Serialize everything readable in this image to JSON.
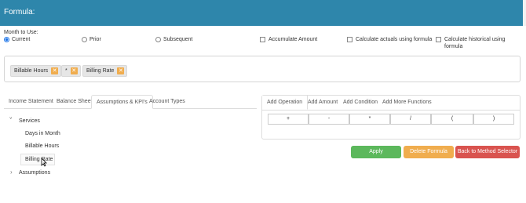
{
  "header": {
    "title": "Formula:"
  },
  "month": {
    "label": "Month to Use:",
    "options": [
      "Current",
      "Prior",
      "Subsequent"
    ],
    "selected": "Current"
  },
  "checkboxes": [
    "Accumulate Amount",
    "Calculate actuals using formula",
    "Calculate historical using formula"
  ],
  "formula_tokens": [
    {
      "label": "Billable Hours",
      "remove_icon": "close-icon"
    },
    {
      "label": "*",
      "remove_icon": "close-icon"
    },
    {
      "label": "Billing Rate",
      "remove_icon": "close-icon"
    }
  ],
  "left_tabs": [
    "Income Statement",
    "Balance Sheet",
    "Assumptions & KPI's",
    "Account Types"
  ],
  "active_left_tab": "Assumptions & KPI's",
  "tree": {
    "groups": [
      {
        "label": "Services",
        "expanded": true,
        "caret": "˅",
        "items": [
          "Days in Month",
          "Billable Hours",
          "Billing Rate"
        ]
      },
      {
        "label": "Assumptions",
        "expanded": false,
        "caret": "›",
        "items": []
      }
    ],
    "selected_item": "Billing Rate"
  },
  "right_tabs": [
    "Add Operation",
    "Add Amount",
    "Add Condition",
    "Add More Functions"
  ],
  "active_right_tab": "Add Operation",
  "operations": [
    "+",
    "-",
    "*",
    "/",
    "(",
    ")"
  ],
  "buttons": {
    "apply": "Apply",
    "delete": "Delete Formula",
    "back": "Back to Method Selector"
  },
  "colors": {
    "header": "#2e86ab",
    "radio_accent": "#1a73e8",
    "token_remove": "#f0ad4e",
    "apply": "#5cb85c",
    "delete": "#f0ad4e",
    "back": "#d9534f"
  }
}
